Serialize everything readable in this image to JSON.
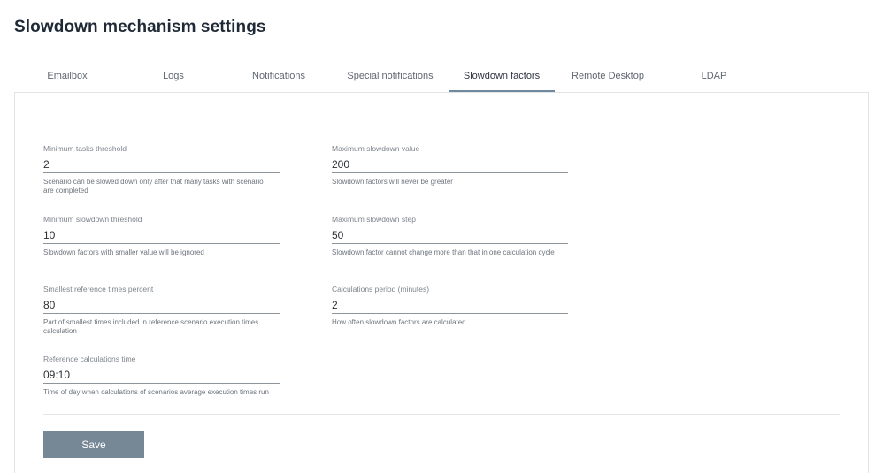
{
  "page": {
    "title": "Slowdown mechanism settings"
  },
  "tabs": [
    {
      "label": "Emailbox"
    },
    {
      "label": "Logs"
    },
    {
      "label": "Notifications"
    },
    {
      "label": "Special notifications"
    },
    {
      "label": "Slowdown factors",
      "active": true
    },
    {
      "label": "Remote Desktop"
    },
    {
      "label": "LDAP"
    }
  ],
  "fields": {
    "min_tasks_threshold": {
      "label": "Minimum tasks threshold",
      "value": "2",
      "help": "Scenario can be slowed down only after that many tasks with scenario are completed"
    },
    "max_slowdown_value": {
      "label": "Maximum slowdown value",
      "value": "200",
      "help": "Slowdown factors will never be greater"
    },
    "min_slowdown_threshold": {
      "label": "Minimum slowdown threshold",
      "value": "10",
      "help": "Slowdown factors with smaller value will be ignored"
    },
    "max_slowdown_step": {
      "label": "Maximum slowdown step",
      "value": "50",
      "help": "Slowdown factor cannot change more than that in one calculation cycle"
    },
    "smallest_reference_percent": {
      "label": "Smallest reference times percent",
      "value": "80",
      "help": "Part of smallest times included in reference scenario execution times calculation"
    },
    "calculations_period": {
      "label": "Calculations period (minutes)",
      "value": "2",
      "help": "How often slowdown factors are calculated"
    },
    "reference_calc_time": {
      "label": "Reference calculations time",
      "value": "09:10",
      "help": "Time of day when calculations of scenarios average execution times run"
    }
  },
  "actions": {
    "save_label": "Save"
  },
  "colors": {
    "accent": "#768896",
    "tab_underline": "#6f8a9e",
    "title": "#1f2a36"
  }
}
